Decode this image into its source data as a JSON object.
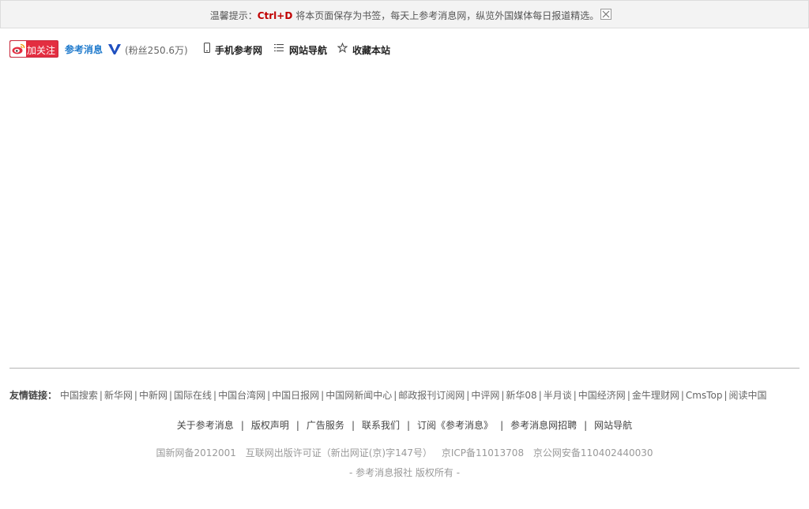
{
  "tipbar": {
    "prefix": "温馨提示：",
    "hotkey": "Ctrl+D",
    "message": "将本页面保存为书签，每天上参考消息网，纵览外国媒体每日报道精选。",
    "close_icon": "close-icon"
  },
  "topbar": {
    "follow_label": "加关注",
    "follow_icon": "weibo-icon",
    "brand_name": "参考消息",
    "verified_icon": "verified-v-icon",
    "fans": "(粉丝250.6万)",
    "links": [
      {
        "label": "手机参考网",
        "icon": "mobile-phone-icon"
      },
      {
        "label": "网站导航",
        "icon": "list-icon"
      },
      {
        "label": "收藏本站",
        "icon": "star-icon"
      }
    ]
  },
  "friend_links": {
    "title": "友情链接：",
    "items": [
      "中国搜索",
      "新华网",
      "中新网",
      "国际在线",
      "中国台湾网",
      "中国日报网",
      "中国网新闻中心",
      "邮政报刊订阅网",
      "中评网",
      "新华08",
      "半月谈",
      "中国经济网",
      "金牛理财网",
      "CmsTop",
      "阅读中国"
    ]
  },
  "footer_nav": [
    "关于参考消息",
    "版权声明",
    "广告服务",
    "联系我们",
    "订阅《参考消息》",
    "参考消息网招聘",
    "网站导航"
  ],
  "footer_icp": [
    "国新网备2012001",
    "互联网出版许可证（新出网证(京)字147号）",
    "京ICP备11013708",
    "京公网安备110402440030"
  ],
  "footer_copy": "- 参考消息报社 版权所有 -",
  "colors": {
    "follow_red": "#e32e41",
    "brand_blue": "#1f7acc",
    "hotkey_red": "#c00000"
  }
}
